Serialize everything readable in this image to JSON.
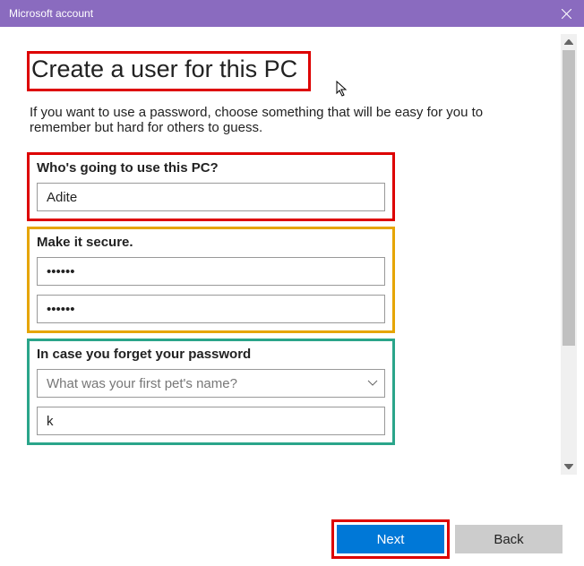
{
  "window": {
    "title": "Microsoft account"
  },
  "heading": "Create a user for this PC",
  "intro": "If you want to use a password, choose something that will be easy for you to remember but hard for others to guess.",
  "section_user": {
    "label": "Who's going to use this PC?",
    "username_value": "Adite"
  },
  "section_secure": {
    "label": "Make it secure.",
    "password_value": "••••••",
    "confirm_value": "••••••"
  },
  "section_forgot": {
    "label": "In case you forget your password",
    "question_selected": "What was your first pet's name?",
    "answer_value": "k"
  },
  "buttons": {
    "next": "Next",
    "back": "Back"
  }
}
